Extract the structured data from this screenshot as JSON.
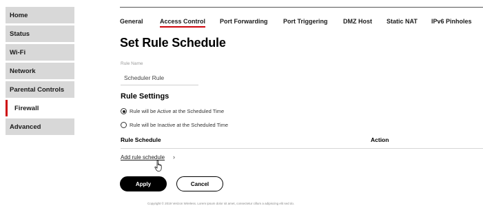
{
  "sidebar": {
    "items": [
      {
        "label": "Home"
      },
      {
        "label": "Status"
      },
      {
        "label": "Wi-Fi"
      },
      {
        "label": "Network"
      },
      {
        "label": "Parental Controls"
      },
      {
        "label": "Firewall",
        "active": true
      },
      {
        "label": "Advanced"
      }
    ]
  },
  "tabs": [
    {
      "label": "General"
    },
    {
      "label": "Access Control",
      "active": true
    },
    {
      "label": "Port Forwarding"
    },
    {
      "label": "Port Triggering"
    },
    {
      "label": "DMZ Host"
    },
    {
      "label": "Static NAT"
    },
    {
      "label": "IPv6 Pinholes"
    }
  ],
  "page": {
    "title": "Set Rule Schedule"
  },
  "form": {
    "rule_name_label": "Rule Name",
    "rule_name_value": "Scheduler Rule",
    "settings_title": "Rule Settings",
    "radio_active": "Rule will be Active at the Scheduled Time",
    "radio_inactive": "Rule will be Inactive at the Scheduled Time",
    "selected": "active"
  },
  "table": {
    "headers": [
      "Rule Schedule",
      "Action"
    ]
  },
  "add_link": "Add rule schedule",
  "buttons": {
    "apply": "Apply",
    "cancel": "Cancel"
  },
  "footer": "Copyright © 2019 Verizon Wireless. Lorem ipsum dolor sit amet, consectetur cillum a adipiscing elit sed do.",
  "colors": {
    "accent": "#cd040b",
    "sidebar_bg": "#d8d8d8"
  }
}
